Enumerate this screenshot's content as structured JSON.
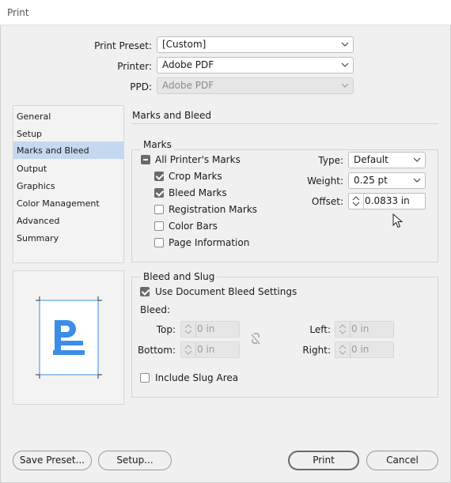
{
  "window": {
    "title": "Print"
  },
  "top": {
    "preset_label": "Print Preset:",
    "preset_value": "[Custom]",
    "printer_label": "Printer:",
    "printer_value": "Adobe PDF",
    "ppd_label": "PPD:",
    "ppd_value": "Adobe PDF"
  },
  "nav": {
    "items": [
      {
        "label": "General"
      },
      {
        "label": "Setup"
      },
      {
        "label": "Marks and Bleed"
      },
      {
        "label": "Output"
      },
      {
        "label": "Graphics"
      },
      {
        "label": "Color Management"
      },
      {
        "label": "Advanced"
      },
      {
        "label": "Summary"
      }
    ],
    "active_index": 2
  },
  "section_title": "Marks and Bleed",
  "marks": {
    "title": "Marks",
    "all_printers_marks": "All Printer's Marks",
    "crop_marks": "Crop Marks",
    "bleed_marks": "Bleed Marks",
    "registration_marks": "Registration Marks",
    "color_bars": "Color Bars",
    "page_information": "Page Information",
    "type_label": "Type:",
    "type_value": "Default",
    "weight_label": "Weight:",
    "weight_value": "0.25 pt",
    "offset_label": "Offset:",
    "offset_value": "0.0833 in"
  },
  "bleed": {
    "title": "Bleed and Slug",
    "use_document": "Use Document Bleed Settings",
    "bleed_label": "Bleed:",
    "top_label": "Top:",
    "top_value": "0 in",
    "bottom_label": "Bottom:",
    "bottom_value": "0 in",
    "left_label": "Left:",
    "left_value": "0 in",
    "right_label": "Right:",
    "right_value": "0 in",
    "include_slug": "Include Slug Area"
  },
  "buttons": {
    "save_preset": "Save Preset...",
    "setup": "Setup...",
    "print": "Print",
    "cancel": "Cancel"
  },
  "colors": {
    "accent": "#3a8ee6",
    "selection": "#c4d8f0"
  }
}
